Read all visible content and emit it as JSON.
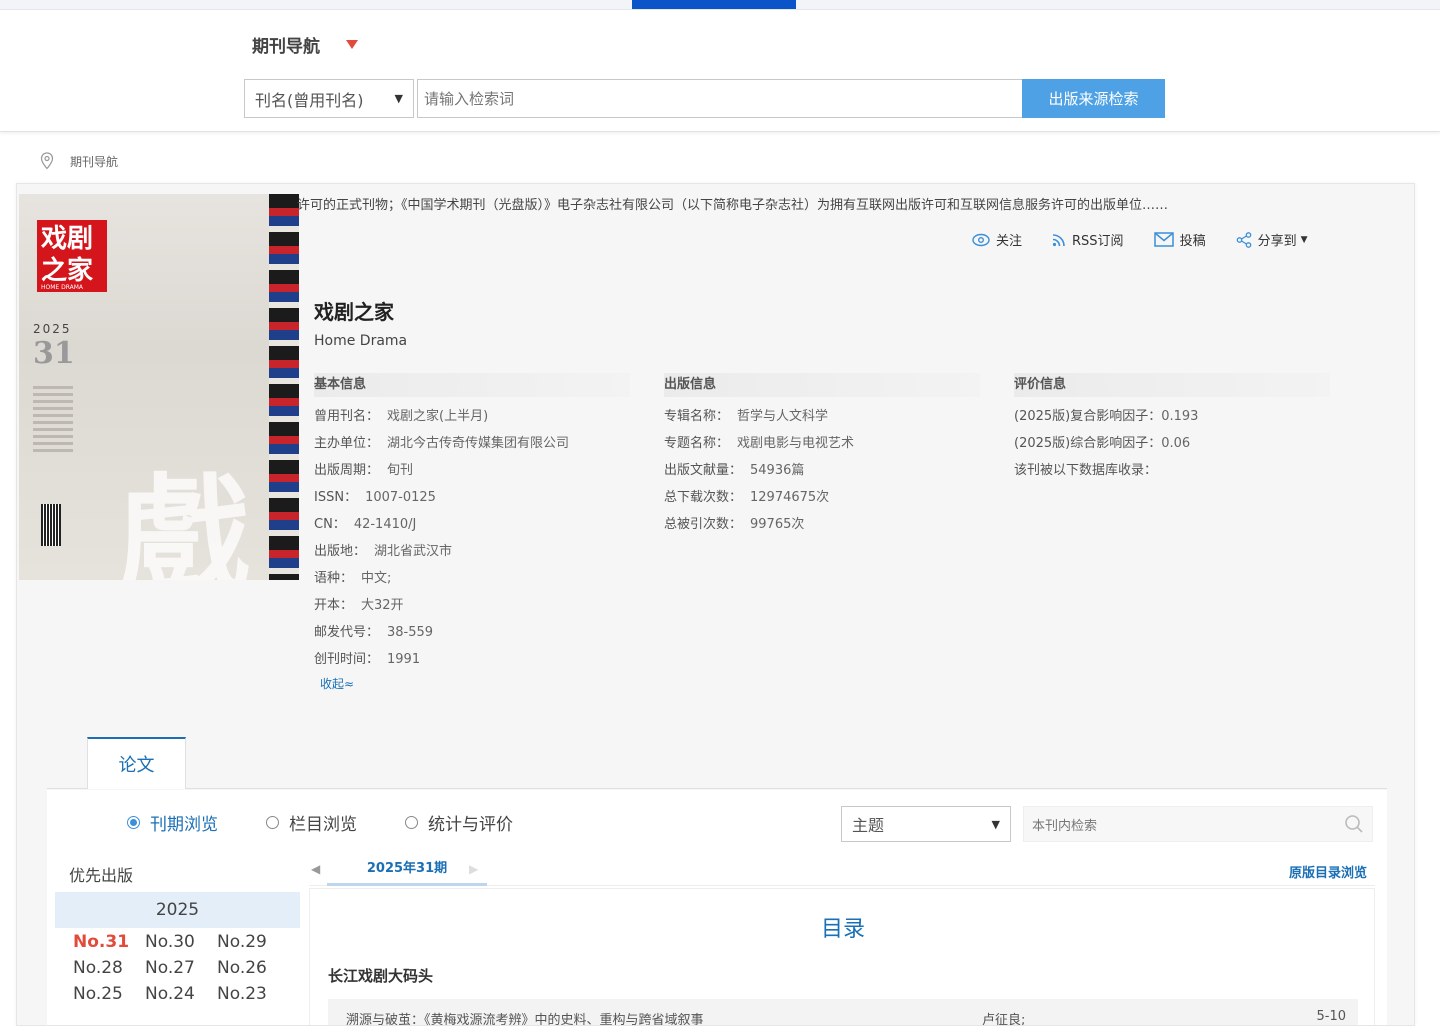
{
  "header": {
    "nav_title": "期刊导航",
    "search_field": "刊名(曾用刊名)",
    "search_placeholder": "请输入检索词",
    "search_button": "出版来源检索"
  },
  "breadcrumb": {
    "label": "期刊导航"
  },
  "cover": {
    "logo_text": "戏剧之家",
    "logo_sub": "HOME DRAMA",
    "year": "2025",
    "issue": "31",
    "big_char": "戲"
  },
  "intro_text": "许可的正式刊物；《中国学术期刊（光盘版）》电子杂志社有限公司（以下简称电子杂志社）为拥有互联网出版许可和互联网信息服务许可的出版单位……",
  "actions": {
    "follow": "关注",
    "rss": "RSS订阅",
    "submit": "投稿",
    "share": "分享到"
  },
  "journal": {
    "title_cn": "戏剧之家",
    "title_en": "Home Drama"
  },
  "basic_info": {
    "heading": "基本信息",
    "rows": [
      {
        "label": "曾用刊名：",
        "value": "戏剧之家(上半月)"
      },
      {
        "label": "主办单位：",
        "value": "湖北今古传奇传媒集团有限公司"
      },
      {
        "label": "出版周期：",
        "value": "旬刊"
      },
      {
        "label": "ISSN：",
        "value": "1007-0125"
      },
      {
        "label": "CN：",
        "value": "42-1410/J"
      },
      {
        "label": "出版地：",
        "value": "湖北省武汉市"
      },
      {
        "label": "语种：",
        "value": "中文;"
      },
      {
        "label": "开本：",
        "value": "大32开"
      },
      {
        "label": "邮发代号：",
        "value": "38-559"
      },
      {
        "label": "创刊时间：",
        "value": "1991"
      }
    ],
    "collapse": "收起≈"
  },
  "publish_info": {
    "heading": "出版信息",
    "rows": [
      {
        "label": "专辑名称：",
        "value": "哲学与人文科学"
      },
      {
        "label": "专题名称：",
        "value": "戏剧电影与电视艺术"
      },
      {
        "label": "出版文献量：",
        "value": "54936篇"
      },
      {
        "label": "总下载次数：",
        "value": "12974675次"
      },
      {
        "label": "总被引次数：",
        "value": "99765次"
      }
    ]
  },
  "eval_info": {
    "heading": "评价信息",
    "rows": [
      {
        "label": "(2025版)复合影响因子：",
        "value": "0.193"
      },
      {
        "label": "(2025版)综合影响因子：",
        "value": "0.06"
      },
      {
        "label": "该刊被以下数据库收录：",
        "value": ""
      }
    ]
  },
  "tabs": {
    "paper": "论文"
  },
  "browse": {
    "radios": [
      "刊期浏览",
      "栏目浏览",
      "统计与评价"
    ],
    "selected": 0,
    "field_select": "主题",
    "inner_search_placeholder": "本刊内检索",
    "priority_label": "优先出版",
    "year": "2025",
    "issues": [
      "No.31",
      "No.30",
      "No.29",
      "No.28",
      "No.27",
      "No.26",
      "No.25",
      "No.24",
      "No.23"
    ],
    "current_issue": "No.31",
    "period_tab": "2025年31期",
    "original_toc_link": "原版目录浏览"
  },
  "toc": {
    "title": "目录",
    "section": "长江戏剧大码头",
    "rows": [
      {
        "title": "溯源与破茧：《黄梅戏源流考辨》中的史料、重构与跨省域叙事",
        "author": "卢征良;",
        "pages": "5-10"
      }
    ]
  },
  "colors": {
    "accent_blue": "#1a6fb5",
    "search_button": "#4da1e4",
    "highlight_red": "#e24b3b",
    "top_active": "#0a53c8"
  }
}
